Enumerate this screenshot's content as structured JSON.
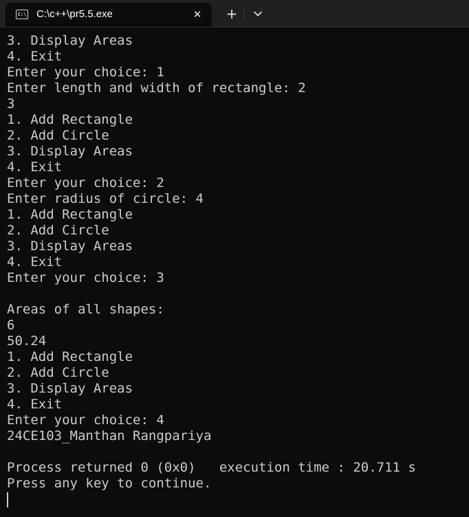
{
  "tab": {
    "icon": "terminal-icon",
    "icon_text": "C:\\",
    "title": "C:\\c++\\pr5.5.exe",
    "close_glyph": "✕",
    "new_tab_glyph": "+",
    "dropdown_icon": "chevron-down-icon"
  },
  "console": {
    "lines": [
      "3. Display Areas",
      "4. Exit",
      "Enter your choice: 1",
      "Enter length and width of rectangle: 2",
      "3",
      "1. Add Rectangle",
      "2. Add Circle",
      "3. Display Areas",
      "4. Exit",
      "Enter your choice: 2",
      "Enter radius of circle: 4",
      "1. Add Rectangle",
      "2. Add Circle",
      "3. Display Areas",
      "4. Exit",
      "Enter your choice: 3",
      "",
      "Areas of all shapes:",
      "6",
      "50.24",
      "1. Add Rectangle",
      "2. Add Circle",
      "3. Display Areas",
      "4. Exit",
      "Enter your choice: 4",
      "24CE103_Manthan Rangpariya",
      "",
      "Process returned 0 (0x0)   execution time : 20.711 s",
      "Press any key to continue."
    ]
  }
}
